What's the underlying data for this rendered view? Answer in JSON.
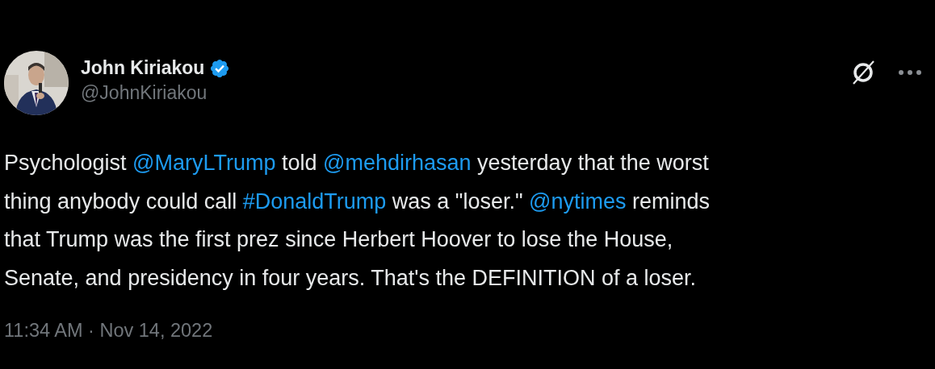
{
  "author": {
    "name": "John Kiriakou",
    "verified": true,
    "handle": "@JohnKiriakou"
  },
  "body": {
    "lines": [
      [
        {
          "kind": "text",
          "text": "Psychologist "
        },
        {
          "kind": "mention",
          "text": "@MaryLTrump"
        },
        {
          "kind": "text",
          "text": " told "
        },
        {
          "kind": "mention",
          "text": "@mehdirhasan"
        },
        {
          "kind": "text",
          "text": " yesterday that the worst"
        }
      ],
      [
        {
          "kind": "text",
          "text": "thing anybody could call "
        },
        {
          "kind": "hashtag",
          "text": "#DonaldTrump"
        },
        {
          "kind": "text",
          "text": " was a \"loser.\" "
        },
        {
          "kind": "mention",
          "text": "@nytimes"
        },
        {
          "kind": "text",
          "text": " reminds"
        }
      ],
      [
        {
          "kind": "text",
          "text": "that Trump was the first prez since Herbert Hoover to lose the House,"
        }
      ],
      [
        {
          "kind": "text",
          "text": "Senate, and presidency in four years. That's the DEFINITION of a loser."
        }
      ]
    ]
  },
  "timestamp": "11:34 AM · Nov 14, 2022"
}
